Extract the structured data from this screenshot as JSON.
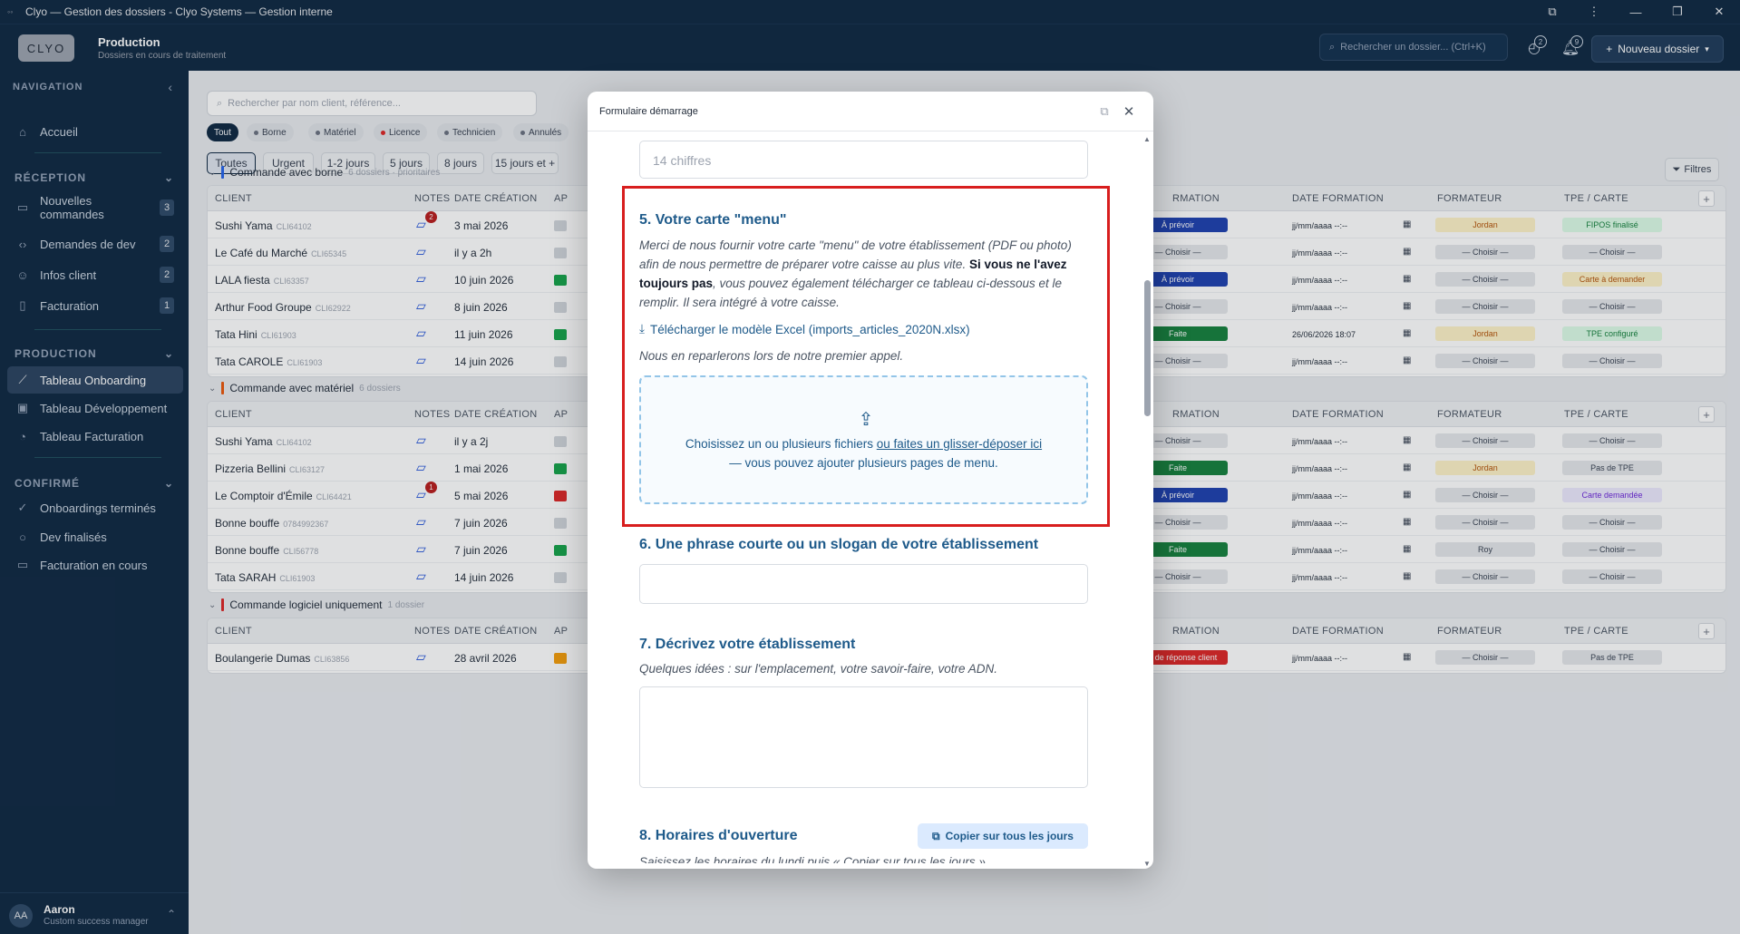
{
  "window": {
    "title": "Clyo — Gestion des dossiers - Clyo Systems — Gestion interne",
    "controls": [
      "⧉",
      "⋮",
      "—",
      "❐",
      "✕"
    ]
  },
  "header": {
    "logo": "CLYO",
    "title": "Production",
    "subtitle": "Dossiers en cours de traitement",
    "search_placeholder": "Rechercher un dossier... (Ctrl+K)",
    "history_badge": "2",
    "notif_badge": "9",
    "new_button": "Nouveau dossier"
  },
  "sidebar": {
    "nav_label": "NAVIGATION",
    "home": "Accueil",
    "sections": [
      {
        "title": "RÉCEPTION",
        "items": [
          {
            "label": "Nouvelles commandes",
            "count": "3"
          },
          {
            "label": "Demandes de dev",
            "count": "2"
          },
          {
            "label": "Infos client",
            "count": "2"
          },
          {
            "label": "Facturation",
            "count": "1"
          }
        ]
      },
      {
        "title": "PRODUCTION",
        "items": [
          {
            "label": "Tableau Onboarding"
          },
          {
            "label": "Tableau Développement"
          },
          {
            "label": "Tableau Facturation"
          }
        ]
      },
      {
        "title": "CONFIRMÉ",
        "items": [
          {
            "label": "Onboardings terminés"
          },
          {
            "label": "Dev finalisés"
          },
          {
            "label": "Facturation en cours"
          }
        ]
      }
    ],
    "user": {
      "initials": "AA",
      "name": "Aaron",
      "role": "Custom success manager"
    }
  },
  "main": {
    "search_placeholder": "Rechercher par nom client, référence...",
    "chips": [
      "Tout",
      "Borne",
      "Matériel",
      "Licence",
      "Technicien",
      "Annulés"
    ],
    "filters": [
      "Toutes",
      "Urgent",
      "1-2 jours",
      "5 jours",
      "8 jours",
      "15 jours et +"
    ],
    "filters_button": "Filtres",
    "columns": {
      "client": "CLIENT",
      "notes": "NOTES",
      "created": "DATE CRÉATION",
      "ap": "AP",
      "formation": "RMATION",
      "date_formation": "DATE FORMATION",
      "formateur": "FORMATEUR",
      "tpe": "TPE / CARTE"
    },
    "groups": [
      {
        "title": "Commande avec borne",
        "subtitle": "6 dossiers · prioritaires",
        "color": "#2563eb",
        "rows": [
          {
            "client": "Sushi Yama",
            "id": "CLI64102",
            "badge": "2",
            "date": "3 mai 2026",
            "ap": "#d1d5db",
            "formation": "À prévoir",
            "fcolor": "blue",
            "dateform": "jj/mm/aaaa --:--",
            "formateur": "Jordan",
            "fmcolor": "amber",
            "tpe": "FIPOS finalisé",
            "tcolor": "green"
          },
          {
            "client": "Le Café du Marché",
            "id": "CLI65345",
            "badge": "",
            "date": "il y a 2h",
            "ap": "#d1d5db",
            "formation": "— Choisir —",
            "fcolor": "gray",
            "dateform": "jj/mm/aaaa --:--",
            "formateur": "— Choisir —",
            "fmcolor": "gray",
            "tpe": "— Choisir —",
            "tcolor": "gray"
          },
          {
            "client": "LALA fiesta",
            "id": "CLI63357",
            "badge": "",
            "date": "10 juin 2026",
            "ap": "#16a34a",
            "formation": "À prévoir",
            "fcolor": "blue",
            "dateform": "jj/mm/aaaa --:--",
            "formateur": "— Choisir —",
            "fmcolor": "gray",
            "tpe": "Carte à demander",
            "tcolor": "amber"
          },
          {
            "client": "Arthur Food Groupe",
            "id": "CLI62922",
            "badge": "",
            "date": "8 juin 2026",
            "ap": "#d1d5db",
            "formation": "— Choisir —",
            "fcolor": "gray",
            "dateform": "jj/mm/aaaa --:--",
            "formateur": "— Choisir —",
            "fmcolor": "gray",
            "tpe": "— Choisir —",
            "tcolor": "gray"
          },
          {
            "client": "Tata Hini",
            "id": "CLI61903",
            "badge": "",
            "date": "11 juin 2026",
            "ap": "#16a34a",
            "formation": "Faite",
            "fcolor": "green",
            "dateform": "26/06/2026 18:07",
            "formateur": "Jordan",
            "fmcolor": "amber",
            "tpe": "TPE configuré",
            "tcolor": "green"
          },
          {
            "client": "Tata CAROLE",
            "id": "CLI61903",
            "badge": "",
            "date": "14 juin 2026",
            "ap": "#d1d5db",
            "formation": "— Choisir —",
            "fcolor": "gray",
            "dateform": "jj/mm/aaaa --:--",
            "formateur": "— Choisir —",
            "fmcolor": "gray",
            "tpe": "— Choisir —",
            "tcolor": "gray"
          }
        ]
      },
      {
        "title": "Commande avec matériel",
        "subtitle": "6 dossiers",
        "color": "#ea580c",
        "rows": [
          {
            "client": "Sushi Yama",
            "id": "CLI64102",
            "badge": "",
            "date": "il y a 2j",
            "ap": "#d1d5db",
            "formation": "— Choisir —",
            "fcolor": "gray",
            "dateform": "jj/mm/aaaa --:--",
            "formateur": "— Choisir —",
            "fmcolor": "gray",
            "tpe": "— Choisir —",
            "tcolor": "gray"
          },
          {
            "client": "Pizzeria Bellini",
            "id": "CLI63127",
            "badge": "",
            "date": "1 mai 2026",
            "ap": "#16a34a",
            "formation": "Faite",
            "fcolor": "green",
            "dateform": "jj/mm/aaaa --:--",
            "formateur": "Jordan",
            "fmcolor": "amber",
            "tpe": "Pas de TPE",
            "tcolor": "gray"
          },
          {
            "client": "Le Comptoir d'Émile",
            "id": "CLI64421",
            "badge": "1",
            "date": "5 mai 2026",
            "ap": "#dc2626",
            "formation": "À prévoir",
            "fcolor": "blue",
            "dateform": "jj/mm/aaaa --:--",
            "formateur": "— Choisir —",
            "fmcolor": "gray",
            "tpe": "Carte demandée",
            "tcolor": "purple"
          },
          {
            "client": "Bonne bouffe",
            "id": "0784992367",
            "badge": "",
            "date": "7 juin 2026",
            "ap": "#d1d5db",
            "formation": "— Choisir —",
            "fcolor": "gray",
            "dateform": "jj/mm/aaaa --:--",
            "formateur": "— Choisir —",
            "fmcolor": "gray",
            "tpe": "— Choisir —",
            "tcolor": "gray"
          },
          {
            "client": "Bonne bouffe",
            "id": "CLI56778",
            "badge": "",
            "date": "7 juin 2026",
            "ap": "#16a34a",
            "formation": "Faite",
            "fcolor": "green",
            "dateform": "jj/mm/aaaa --:--",
            "formateur": "Roy",
            "fmcolor": "gray",
            "tpe": "— Choisir —",
            "tcolor": "gray"
          },
          {
            "client": "Tata SARAH",
            "id": "CLI61903",
            "badge": "",
            "date": "14 juin 2026",
            "ap": "#d1d5db",
            "formation": "— Choisir —",
            "fcolor": "gray",
            "dateform": "jj/mm/aaaa --:--",
            "formateur": "— Choisir —",
            "fmcolor": "gray",
            "tpe": "— Choisir —",
            "tcolor": "gray"
          }
        ]
      },
      {
        "title": "Commande logiciel uniquement",
        "subtitle": "1 dossier",
        "color": "#dc2626",
        "rows": [
          {
            "client": "Boulangerie Dumas",
            "id": "CLI63856",
            "badge": "",
            "date": "28 avril 2026",
            "ap": "#f59e0b",
            "formation": "Pas de réponse client",
            "fcolor": "red",
            "dateform": "jj/mm/aaaa --:--",
            "formateur": "— Choisir —",
            "fmcolor": "gray",
            "tpe": "Pas de TPE",
            "tcolor": "gray"
          }
        ]
      }
    ]
  },
  "modal": {
    "title": "Formulaire démarrage",
    "siret_placeholder": "14 chiffres",
    "q5": {
      "title": "5. Votre carte \"menu\"",
      "desc1": "Merci de nous fournir votre carte \"menu\" de votre établissement (PDF ou photo) afin de nous permettre de préparer votre caisse au plus vite.",
      "desc2_bold": "Si vous ne l'avez toujours pas",
      "desc2": ", vous pouvez également télécharger ce tableau ci-dessous et le remplir. Il sera intégré à votre caisse.",
      "download": "Télécharger le modèle Excel (imports_articles_2020N.xlsx)",
      "note": "Nous en reparlerons lors de notre premier appel.",
      "drop_text": "Choisissez un ou plusieurs fichiers ",
      "drop_link": "ou faites un glisser-déposer ici",
      "drop_line2": "— vous pouvez ajouter plusieurs pages de menu."
    },
    "q6": {
      "title": "6. Une phrase courte ou un slogan de votre établissement"
    },
    "q7": {
      "title": "7. Décrivez votre établissement",
      "desc": "Quelques idées : sur l'emplacement, votre savoir-faire, votre ADN."
    },
    "q8": {
      "title": "8. Horaires d'ouverture",
      "copy_button": "Copier sur tous les jours",
      "desc": "Saisissez les horaires du lundi puis « Copier sur tous les jours »."
    }
  }
}
